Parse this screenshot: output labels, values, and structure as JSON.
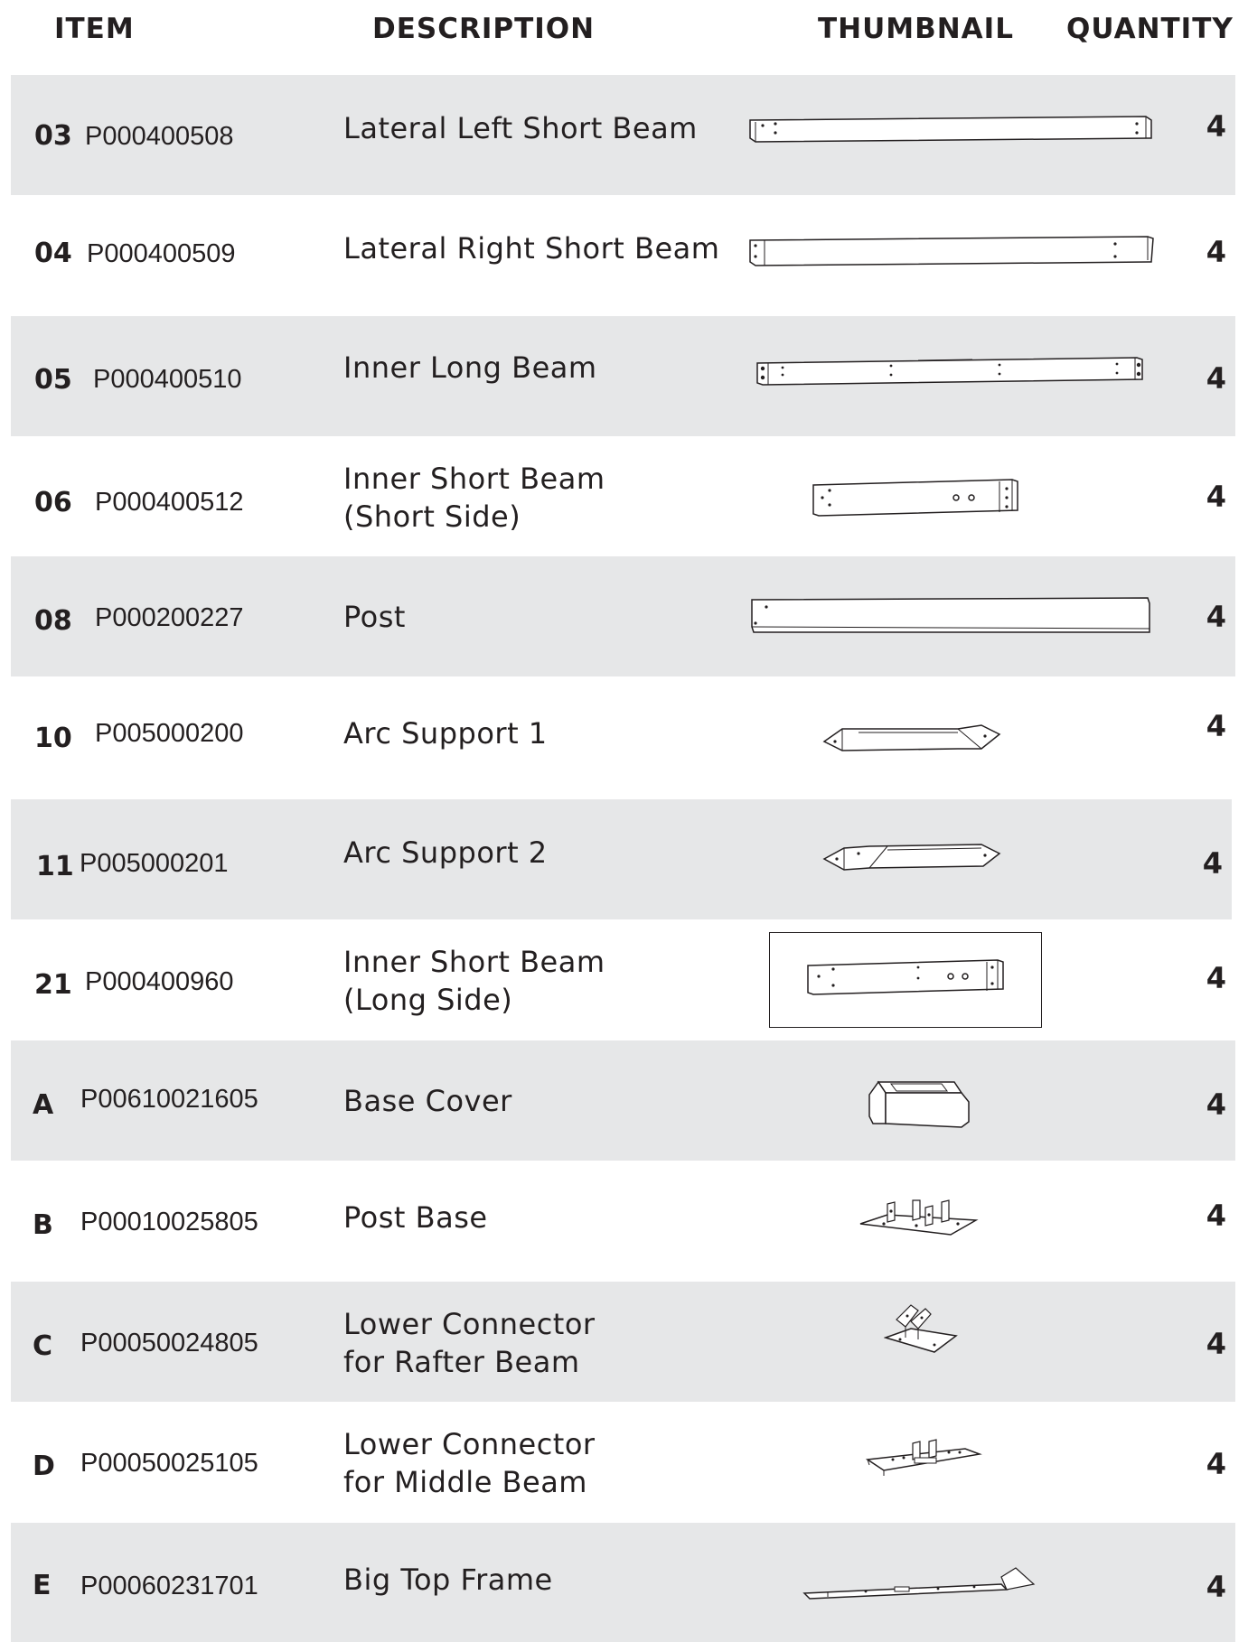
{
  "header": {
    "item": "ITEM",
    "description": "DESCRIPTION",
    "thumbnail": "THUMBNAIL",
    "quantity": "QUANTITY"
  },
  "rows": [
    {
      "code": "03",
      "part": "P000400508",
      "description": [
        "Lateral Left Short Beam"
      ],
      "quantity": "4",
      "thumbnail_icon": "lateral-left-short-beam-icon"
    },
    {
      "code": "04",
      "part": "P000400509",
      "description": [
        "Lateral Right Short Beam"
      ],
      "quantity": "4",
      "thumbnail_icon": "lateral-right-short-beam-icon"
    },
    {
      "code": "05",
      "part": "P000400510",
      "description": [
        "Inner Long Beam"
      ],
      "quantity": "4",
      "thumbnail_icon": "inner-long-beam-icon"
    },
    {
      "code": "06",
      "part": "P000400512",
      "description": [
        "Inner Short Beam",
        "(Short Side)"
      ],
      "quantity": "4",
      "thumbnail_icon": "inner-short-beam-short-side-icon"
    },
    {
      "code": "08",
      "part": "P000200227",
      "description": [
        "Post"
      ],
      "quantity": "4",
      "thumbnail_icon": "post-icon"
    },
    {
      "code": "10",
      "part": "P005000200",
      "description": [
        "Arc Support 1"
      ],
      "quantity": "4",
      "thumbnail_icon": "arc-support-1-icon"
    },
    {
      "code": "11",
      "part": "P005000201",
      "description": [
        "Arc Support 2"
      ],
      "quantity": "4",
      "thumbnail_icon": "arc-support-2-icon"
    },
    {
      "code": "21",
      "part": "P000400960",
      "description": [
        "Inner Short Beam",
        "(Long Side)"
      ],
      "quantity": "4",
      "thumbnail_icon": "inner-short-beam-long-side-icon"
    },
    {
      "code": "A",
      "part": "P00610021605",
      "description": [
        "Base Cover"
      ],
      "quantity": "4",
      "thumbnail_icon": "base-cover-icon"
    },
    {
      "code": "B",
      "part": "P00010025805",
      "description": [
        "Post Base"
      ],
      "quantity": "4",
      "thumbnail_icon": "post-base-icon"
    },
    {
      "code": "C",
      "part": "P00050024805",
      "description": [
        "Lower Connector",
        "for Rafter Beam"
      ],
      "quantity": "4",
      "thumbnail_icon": "lower-connector-rafter-beam-icon"
    },
    {
      "code": "D",
      "part": "P00050025105",
      "description": [
        "Lower Connector",
        "for Middle Beam"
      ],
      "quantity": "4",
      "thumbnail_icon": "lower-connector-middle-beam-icon"
    },
    {
      "code": "E",
      "part": "P00060231701",
      "description": [
        "Big Top Frame"
      ],
      "quantity": "4",
      "thumbnail_icon": "big-top-frame-icon"
    }
  ]
}
